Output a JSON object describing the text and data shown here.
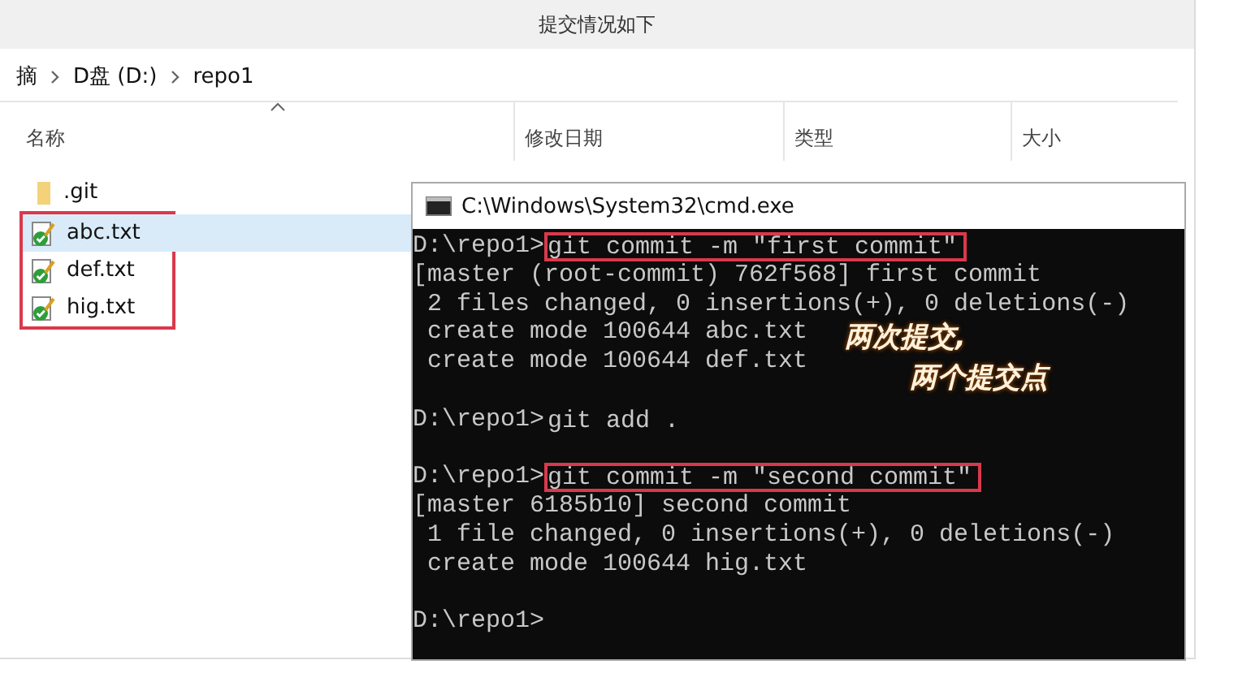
{
  "window": {
    "title": "提交情况如下"
  },
  "breadcrumb": [
    "摘",
    "D盘 (D:)",
    "repo1"
  ],
  "columns": [
    {
      "label": "名称",
      "sorted": true
    },
    {
      "label": "修改日期",
      "sorted": false
    },
    {
      "label": "类型",
      "sorted": false
    },
    {
      "label": "大小",
      "sorted": false
    }
  ],
  "files": [
    {
      "name": ".git",
      "kind": "folder",
      "selected": false,
      "highlighted": false
    },
    {
      "name": "abc.txt",
      "kind": "tracked",
      "selected": true,
      "highlighted": true
    },
    {
      "name": "def.txt",
      "kind": "tracked",
      "selected": false,
      "highlighted": true
    },
    {
      "name": "hig.txt",
      "kind": "tracked",
      "selected": false,
      "highlighted": true
    }
  ],
  "console": {
    "title": "C:\\Windows\\System32\\cmd.exe",
    "lines": [
      {
        "kind": "input",
        "prompt": "D:\\repo1>",
        "command": "git commit -m ″first commit″",
        "boxed": true
      },
      {
        "kind": "output",
        "text": "[master (root-commit) 762f568] first commit"
      },
      {
        "kind": "output",
        "text": " 2 files changed, 0 insertions(+), 0 deletions(-)"
      },
      {
        "kind": "output",
        "text": " create mode 100644 abc.txt"
      },
      {
        "kind": "output",
        "text": " create mode 100644 def.txt"
      },
      {
        "kind": "blank"
      },
      {
        "kind": "input",
        "prompt": "D:\\repo1>",
        "command": "git add .",
        "boxed": false
      },
      {
        "kind": "blank"
      },
      {
        "kind": "input",
        "prompt": "D:\\repo1>",
        "command": "git commit -m ″second commit″",
        "boxed": true
      },
      {
        "kind": "output",
        "text": "[master 6185b10] second commit"
      },
      {
        "kind": "output",
        "text": " 1 file changed, 0 insertions(+), 0 deletions(-)"
      },
      {
        "kind": "output",
        "text": " create mode 100644 hig.txt"
      },
      {
        "kind": "blank"
      },
      {
        "kind": "input",
        "prompt": "D:\\repo1>",
        "boxed": false
      }
    ]
  },
  "annotation": [
    "两次提交,",
    "两个提交点"
  ]
}
